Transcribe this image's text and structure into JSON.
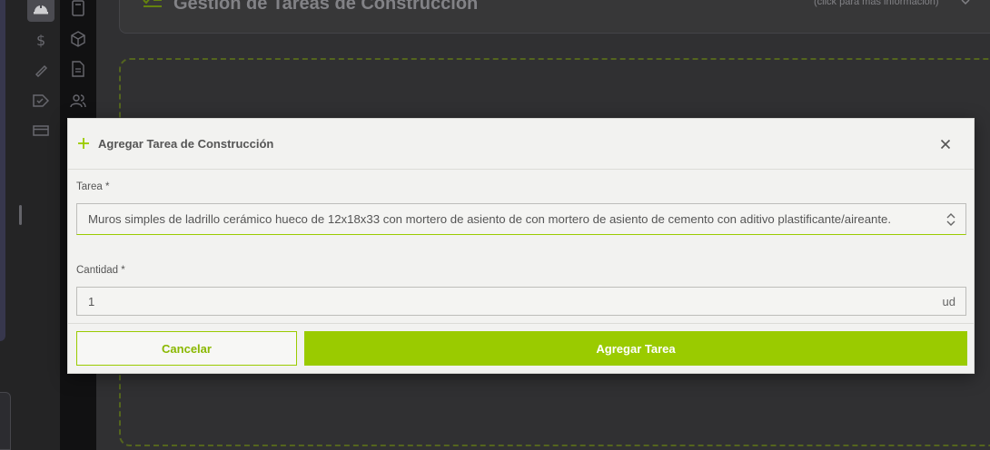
{
  "background": {
    "header_title": "Gestión de Tareas de Construcción",
    "header_hint": "(click para más información)"
  },
  "modal": {
    "title": "Agregar Tarea de Construcción",
    "task_label": "Tarea *",
    "task_selected": "Muros simples de ladrillo cerámico hueco de 12x18x33 con mortero de asiento de con mortero de asiento de cemento con aditivo plastificante/aireante.",
    "quantity_label": "Cantidad *",
    "quantity_value": "1",
    "quantity_unit": "ud",
    "cancel_label": "Cancelar",
    "submit_label": "Agregar Tarea"
  },
  "colors": {
    "accent": "#9acb00",
    "modal_bg": "#f2f2f0",
    "app_bg": "#333335"
  },
  "icons": {
    "rail": [
      "helmet-icon",
      "calculator-icon",
      "dollar-icon",
      "cube-icon",
      "brush-icon",
      "document-icon",
      "tag-icon",
      "users-icon",
      "card-icon"
    ],
    "modal": [
      "plus-icon",
      "close-icon",
      "chevron-updown-icon"
    ]
  }
}
